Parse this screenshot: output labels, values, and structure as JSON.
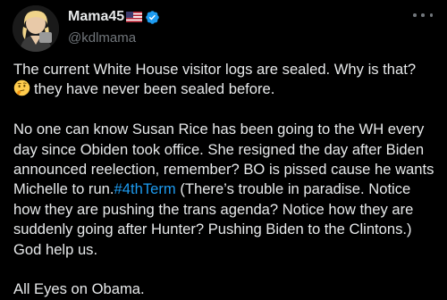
{
  "author": {
    "display_name": "Mama45",
    "handle": "@kdlmama",
    "flag_icon": "us-flag-icon",
    "verified_icon": "verified-badge-icon",
    "verified_color": "#1d9bf0"
  },
  "menu": {
    "icon": "more-horizontal-icon"
  },
  "tweet": {
    "para1_line1": "The current White House visitor logs are sealed. Why is that?",
    "para1_emoji": "thinking-face-emoji",
    "para1_line2": "they have never been sealed before.",
    "para2_before_hashtag": "No one can know Susan Rice has been going to the WH every day since Obiden took office. She resigned the day after Biden announced reelection, remember? BO is pissed cause he wants Michelle to run.",
    "hashtag": "#4thTerm",
    "para2_after_hashtag": " (There’s trouble in paradise. Notice how they are pushing the trans agenda? Notice how they are suddenly going after Hunter? Pushing Biden to the Clintons.) God help us.",
    "para3": "All Eyes on Obama.",
    "hashtag_color": "#1d9bf0"
  }
}
